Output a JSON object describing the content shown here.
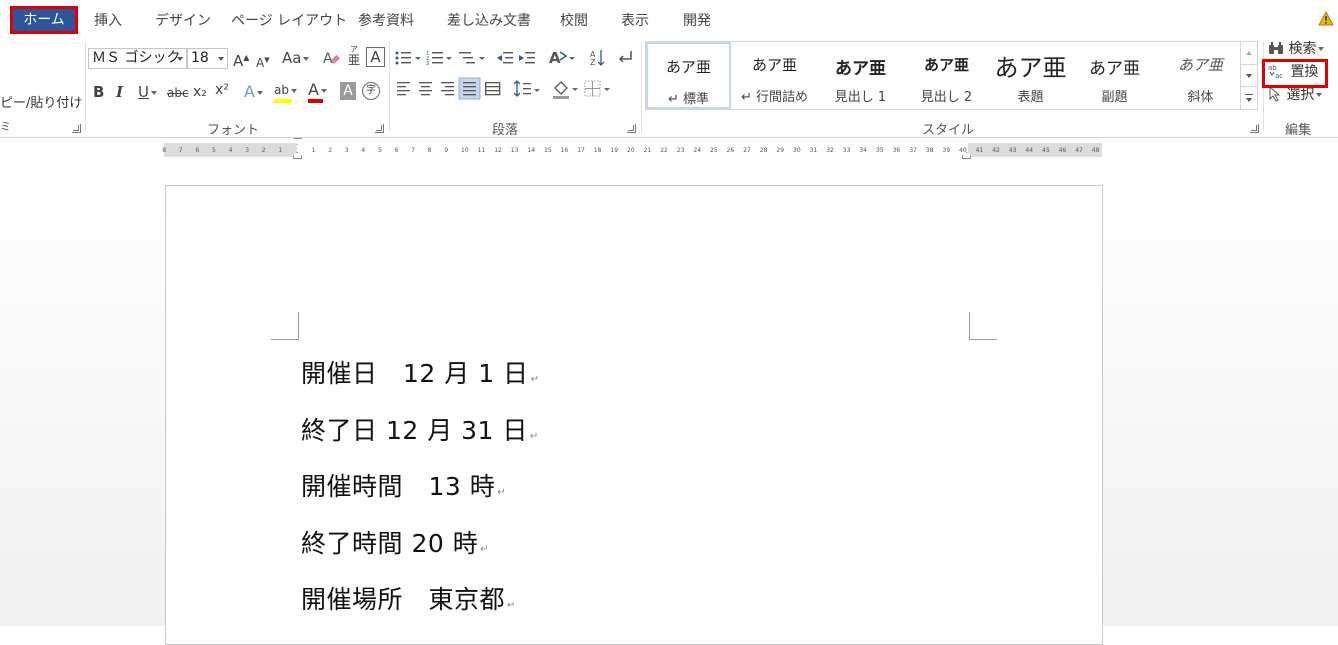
{
  "tabs": {
    "home": "ホーム",
    "insert": "挿入",
    "design": "デザイン",
    "layout": "ページ レイアウト",
    "references": "参考資料",
    "mailings": "差し込み文書",
    "review": "校閲",
    "view": "表示",
    "developer": "開発"
  },
  "clipboard": {
    "paste_label": "ピー/貼り付け",
    "fragment": "ミ"
  },
  "font": {
    "name": "ＭＳ ゴシック (",
    "size": "18",
    "grow": "A",
    "shrink": "A",
    "case": "Aa",
    "phonetic_top": "亜",
    "phonetic_ruby": "ア",
    "border_char": "A",
    "bold": "B",
    "italic": "I",
    "underline": "U",
    "strike": "abc",
    "subscript": "x₂",
    "superscript": "x²",
    "effects": "A",
    "highlight": "ab",
    "color": "A",
    "shading": "A",
    "enclose": "字",
    "group_label": "フォント"
  },
  "paragraph": {
    "group_label": "段落"
  },
  "styles": {
    "items": [
      {
        "preview": "あア亜",
        "name": "↵ 標準",
        "size": "15px",
        "weight": "normal",
        "italic": false
      },
      {
        "preview": "あア亜",
        "name": "↵ 行間詰め",
        "size": "15px",
        "weight": "normal",
        "italic": false
      },
      {
        "preview": "あア亜",
        "name": "見出し 1",
        "size": "17px",
        "weight": "bold",
        "italic": false
      },
      {
        "preview": "あア亜",
        "name": "見出し 2",
        "size": "15px",
        "weight": "bold",
        "italic": false
      },
      {
        "preview": "あア亜",
        "name": "表題",
        "size": "24px",
        "weight": "normal",
        "italic": false
      },
      {
        "preview": "あア亜",
        "name": "副題",
        "size": "17px",
        "weight": "normal",
        "italic": false
      },
      {
        "preview": "あア亜",
        "name": "斜体",
        "size": "15px",
        "weight": "normal",
        "italic": true
      }
    ],
    "group_label": "スタイル"
  },
  "editing": {
    "find": "検索",
    "replace": "置換",
    "select": "選択",
    "group_label": "編集"
  },
  "ruler": {
    "left_ticks": [
      "8",
      "7",
      "6",
      "5",
      "4",
      "3",
      "2",
      "1"
    ],
    "right_ticks": [
      "1",
      "2",
      "3",
      "4",
      "5",
      "6",
      "7",
      "8",
      "9",
      "10",
      "11",
      "12",
      "13",
      "14",
      "15",
      "16",
      "17",
      "18",
      "19",
      "20",
      "21",
      "22",
      "23",
      "24",
      "25",
      "26",
      "27",
      "28",
      "29",
      "30",
      "31",
      "32",
      "33",
      "34",
      "35",
      "36",
      "37",
      "38",
      "39",
      "40",
      "41",
      "42",
      "43",
      "44",
      "45",
      "46",
      "47",
      "48"
    ]
  },
  "document": {
    "lines": [
      "開催日　12 月 1 日",
      "終了日 12 月 31 日",
      "開催時間　13 時",
      "終了時間 20 時",
      "開催場所　東京都"
    ],
    "paragraph_mark": "↵"
  },
  "colors": {
    "accent": "#2b579a",
    "highlight_box": "#e00000",
    "font_color_bar": "#e00000",
    "highlight_bar": "#ffff00"
  }
}
